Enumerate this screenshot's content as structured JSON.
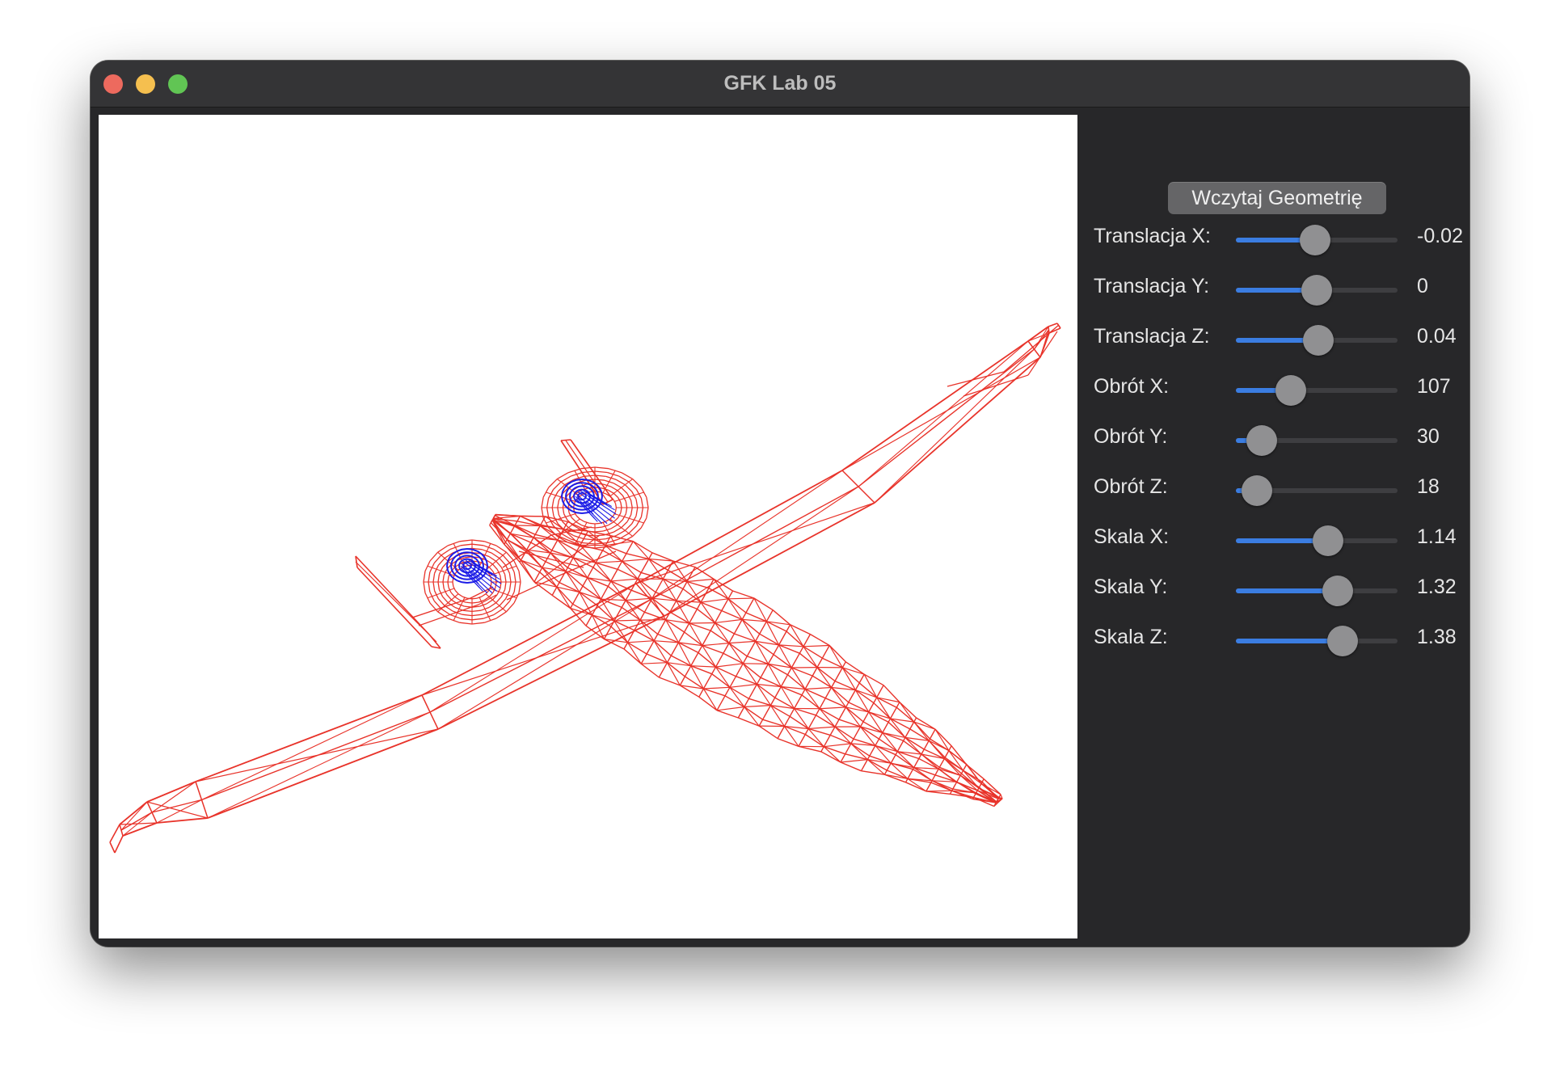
{
  "window": {
    "title": "GFK Lab 05"
  },
  "panel": {
    "load_button": "Wczytaj Geometrię",
    "sliders": [
      {
        "label": "Translacja X:",
        "value": "-0.02",
        "fraction": 0.49
      },
      {
        "label": "Translacja Y:",
        "value": "0",
        "fraction": 0.5
      },
      {
        "label": "Translacja Z:",
        "value": "0.04",
        "fraction": 0.51
      },
      {
        "label": "Obrót X:",
        "value": "107",
        "fraction": 0.34
      },
      {
        "label": "Obrót Y:",
        "value": "30",
        "fraction": 0.16
      },
      {
        "label": "Obrót Z:",
        "value": "18",
        "fraction": 0.13
      },
      {
        "label": "Skala X:",
        "value": "1.14",
        "fraction": 0.57
      },
      {
        "label": "Skala Y:",
        "value": "1.32",
        "fraction": 0.63
      },
      {
        "label": "Skala Z:",
        "value": "1.38",
        "fraction": 0.66
      }
    ]
  },
  "scene": {
    "model": "aircraft-wireframe",
    "mesh_color": "#e8332a",
    "engine_color": "#1a1ae6",
    "background": "#ffffff"
  },
  "colors": {
    "accent": "#3b7de1",
    "window_bg": "#272729"
  }
}
